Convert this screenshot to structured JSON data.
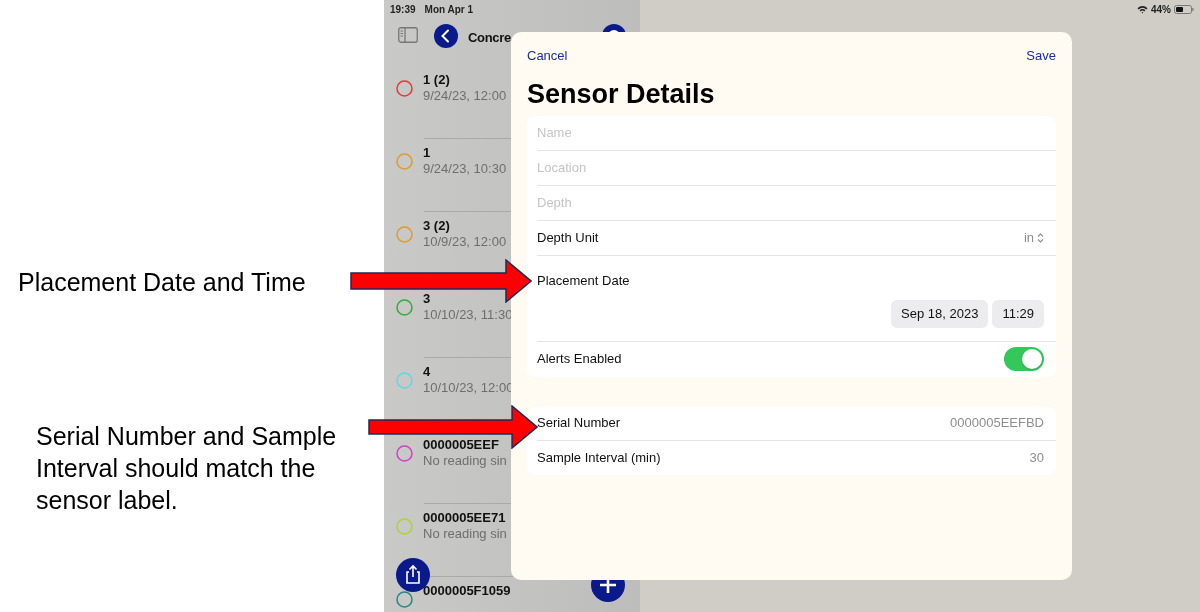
{
  "status_bar": {
    "time": "19:39",
    "date": "Mon Apr 1",
    "battery": "44%"
  },
  "sidebar": {
    "title": "Concre",
    "items": [
      {
        "title": "1 (2)",
        "subtitle": "9/24/23, 12:00",
        "color": "#e03a3a"
      },
      {
        "title": "1",
        "subtitle": "9/24/23, 10:30",
        "color": "#e09a30"
      },
      {
        "title": "3 (2)",
        "subtitle": "10/9/23, 12:00",
        "color": "#e09a30"
      },
      {
        "title": "3",
        "subtitle": "10/10/23, 11:30",
        "color": "#2fae3a"
      },
      {
        "title": "4",
        "subtitle": "10/10/23, 12:00",
        "color": "#5fd8e0"
      },
      {
        "title": "0000005EEF",
        "subtitle": "No reading sin",
        "color": "#d040c8"
      },
      {
        "title": "0000005EE71",
        "subtitle": "No reading sin",
        "color": "#a8d830"
      },
      {
        "title": "0000005F1059",
        "color": "#208a86"
      }
    ]
  },
  "sheet": {
    "cancel": "Cancel",
    "save": "Save",
    "title": "Sensor Details",
    "rows": [
      {
        "kind": "field",
        "placeholder": "Name"
      },
      {
        "kind": "field",
        "placeholder": "Location"
      },
      {
        "kind": "field",
        "placeholder": "Depth"
      },
      {
        "kind": "picker",
        "label": "Depth Unit",
        "value": "in"
      },
      {
        "kind": "date",
        "label": "Placement Date",
        "date": "Sep 18, 2023",
        "time": "11:29"
      },
      {
        "kind": "toggle",
        "label": "Alerts Enabled",
        "on": true
      }
    ],
    "info_rows": [
      {
        "label": "Serial Number",
        "value": "0000005EEFBD"
      },
      {
        "label": "Sample Interval (min)",
        "value": "30"
      }
    ]
  },
  "annotations": [
    {
      "text": "Placement Date and Time"
    },
    {
      "text": "Serial Number and Sample Interval should match the sensor label."
    }
  ]
}
